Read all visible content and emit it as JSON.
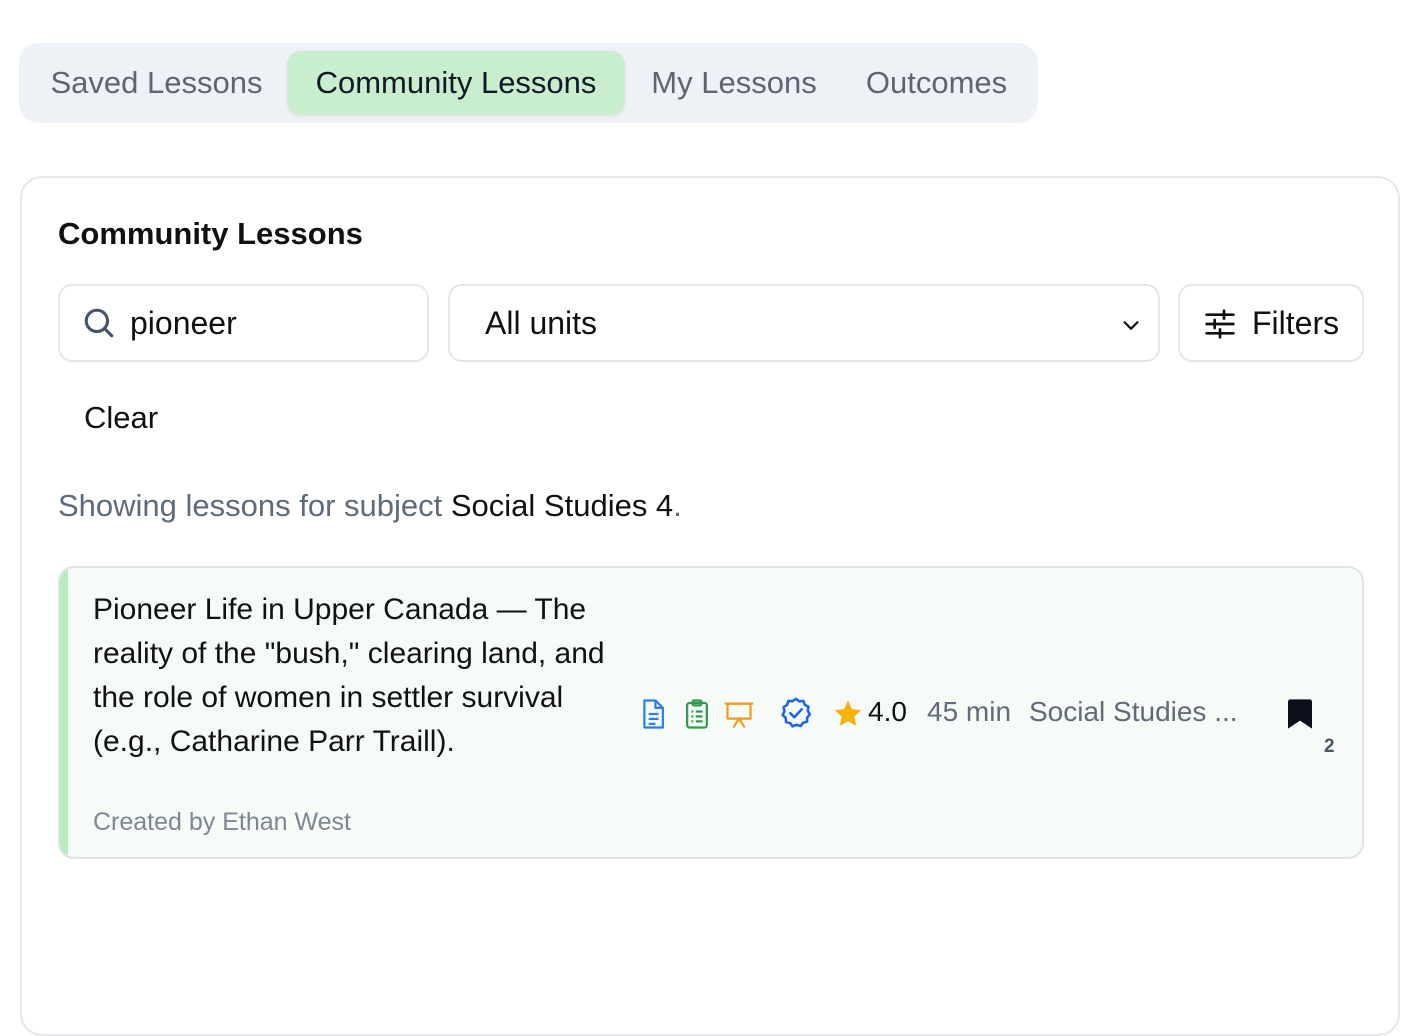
{
  "tabs": [
    {
      "label": "Saved Lessons",
      "active": false
    },
    {
      "label": "Community Lessons",
      "active": true
    },
    {
      "label": "My Lessons",
      "active": false
    },
    {
      "label": "Outcomes",
      "active": false
    }
  ],
  "panel": {
    "title": "Community Lessons",
    "search": {
      "value": "pioneer",
      "icon": "search-icon"
    },
    "unit_select": {
      "selected": "All units",
      "icon": "chevron-down-icon"
    },
    "filters": {
      "label": "Filters",
      "icon": "sliders-icon"
    },
    "clear_label": "Clear",
    "subject_prefix": "Showing lessons for subject ",
    "subject": "Social Studies 4",
    "subject_suffix": "."
  },
  "lessons": [
    {
      "title": "Pioneer Life in Upper Canada — The reality of the \"bush,\" clearing land, and the role of women in settler survival (e.g., Catharine Parr Traill).",
      "author": "Created by Ethan West",
      "icons": [
        "document-icon",
        "clipboard-icon",
        "presentation-icon",
        "verified-badge-icon"
      ],
      "rating": "4.0",
      "duration": "45 min",
      "subject": "Social Studies ...",
      "bookmark_count": "2"
    }
  ],
  "colors": {
    "accent_green": "#c9eecd",
    "document_blue": "#2b7de9",
    "clipboard_green": "#2e9a4c",
    "presentation_orange": "#f29a1d",
    "verified_blue": "#1e63e6",
    "star_yellow": "#f6b30f"
  }
}
